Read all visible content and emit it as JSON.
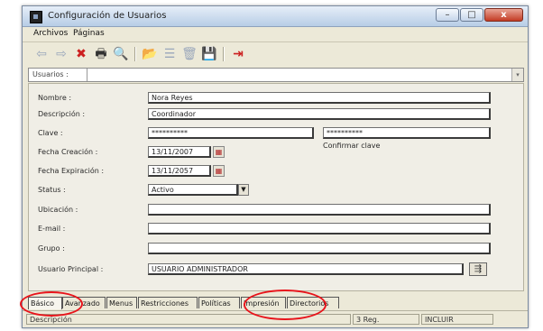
{
  "window": {
    "title": "Configuración de Usuarios",
    "close_glyph": "x",
    "min_glyph": "–",
    "max_glyph": "□"
  },
  "menu": [
    {
      "label": "Archivos"
    },
    {
      "label": "Páginas"
    }
  ],
  "toolbar": {
    "icons": [
      "arrow-left-icon",
      "arrow-right-icon",
      "delete-x-icon",
      "print-icon",
      "search-icon",
      "open-folder-icon",
      "list-icon",
      "trash-icon",
      "save-icon",
      "exit-icon"
    ],
    "glyphs": [
      "⇦",
      "⇨",
      "✖",
      "🖶",
      "🔍",
      "📂",
      "☰",
      "🗑",
      "💾",
      "⇥"
    ]
  },
  "users_bar": {
    "label": "Usuarios :",
    "dropdown_glyph": "▾"
  },
  "form": {
    "nombre": {
      "label": "Nombre :",
      "value": "Nora Reyes"
    },
    "descripcion": {
      "label": "Descripción :",
      "value": "Coordinador"
    },
    "clave": {
      "label": "Clave :",
      "value": "**********",
      "confirm_value": "**********",
      "confirm_label": "Confirmar clave"
    },
    "fecha_creacion": {
      "label": "Fecha Creación :",
      "value": "13/11/2007"
    },
    "fecha_expiracion": {
      "label": "Fecha Expiración :",
      "value": "13/11/2057"
    },
    "status": {
      "label": "Status :",
      "value": "Activo"
    },
    "ubicacion": {
      "label": "Ubicación :",
      "value": ""
    },
    "email": {
      "label": "E-mail :",
      "value": ""
    },
    "grupo": {
      "label": "Grupo :",
      "value": ""
    },
    "usuario_principal": {
      "label": "Usuario Principal :",
      "value": "USUARIO ADMINISTRADOR"
    }
  },
  "tabs": [
    {
      "label": "Básico",
      "active": true
    },
    {
      "label": "Avanzado",
      "active": false
    },
    {
      "label": "Menus",
      "active": false
    },
    {
      "label": "Restricciones",
      "active": false
    },
    {
      "label": "Políticas",
      "active": false
    },
    {
      "label": "Impresión",
      "active": false
    },
    {
      "label": "Directorios",
      "active": false
    }
  ],
  "status_bar": {
    "description": "Descripción",
    "count": "3 Reg.",
    "mode": "INCLUIR"
  },
  "colors": {
    "highlight": "#e8141b",
    "window_bg": "#ece9d8",
    "title_gradient_bottom": "#b7cde6"
  }
}
